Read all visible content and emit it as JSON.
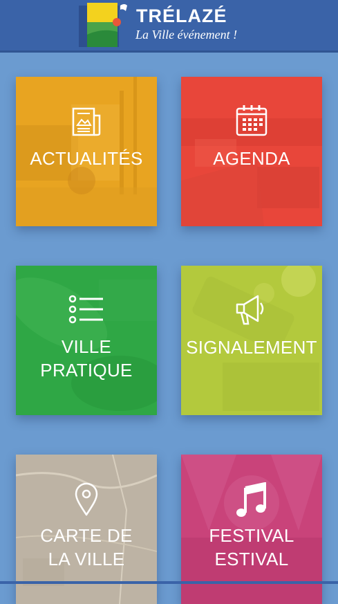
{
  "header": {
    "title": "TRÉLAZÉ",
    "tagline": "La Ville événement !"
  },
  "tiles": [
    {
      "label": "ACTUALITÉS",
      "icon": "newspaper-icon",
      "color": "#e8a421"
    },
    {
      "label": "AGENDA",
      "icon": "calendar-icon",
      "color": "#e8463a"
    },
    {
      "label1": "VILLE",
      "label2": "PRATIQUE",
      "icon": "list-icon",
      "color": "#2fa745"
    },
    {
      "label": "SIGNALEMENT",
      "icon": "megaphone-icon",
      "color": "#b3c93d"
    },
    {
      "label1": "CARTE DE",
      "label2": "LA VILLE",
      "icon": "map-pin-icon",
      "color": "#bdb3a4"
    },
    {
      "label1": "FESTIVAL",
      "label2": "ESTIVAL",
      "icon": "music-note-icon",
      "color": "#c9437a"
    }
  ]
}
